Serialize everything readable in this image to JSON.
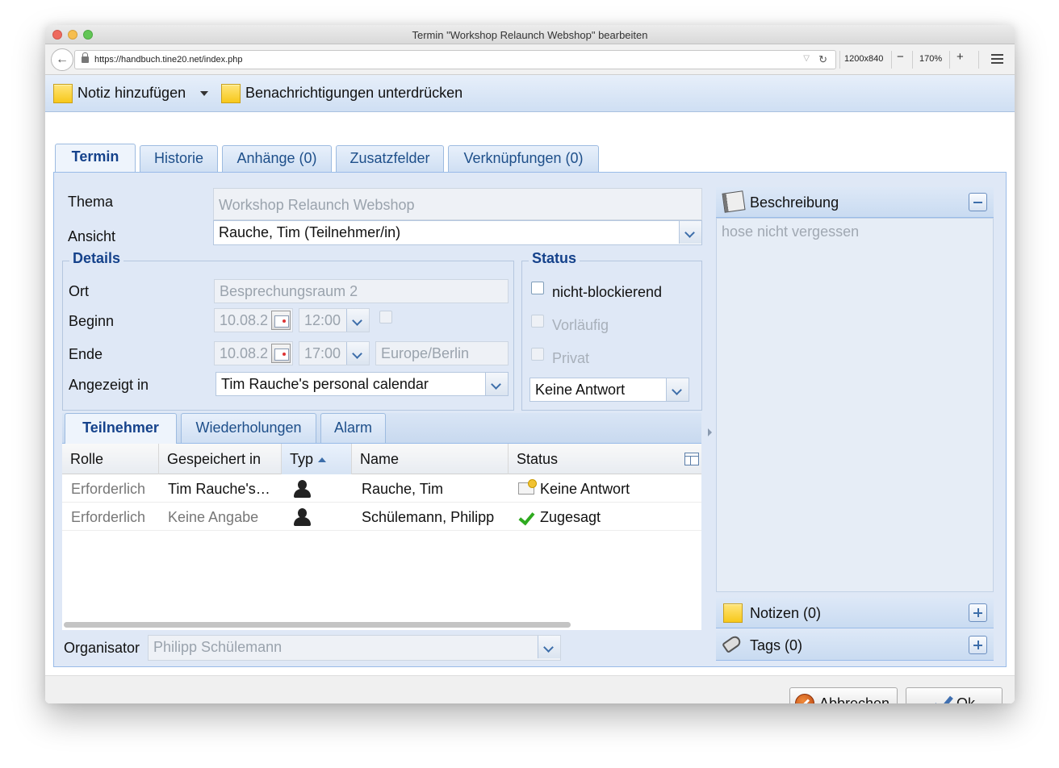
{
  "window": {
    "title": "Termin \"Workshop Relaunch Webshop\" bearbeiten"
  },
  "browser": {
    "url": "https://handbuch.tine20.net/index.php",
    "viewport": "1200x840",
    "zoom": "170%",
    "zoom_out": "−",
    "zoom_in": "+"
  },
  "toolbar": {
    "add_note": "Notiz hinzufügen",
    "suppress_notifications": "Benachrichtigungen unterdrücken"
  },
  "tabs": [
    "Termin",
    "Historie",
    "Anhänge (0)",
    "Zusatzfelder",
    "Verknüpfungen (0)"
  ],
  "form": {
    "thema_label": "Thema",
    "thema_placeholder": "Workshop Relaunch Webshop",
    "ansicht_label": "Ansicht",
    "ansicht_value": "Rauche, Tim (Teilnehmer/in)"
  },
  "details": {
    "legend": "Details",
    "ort_label": "Ort",
    "ort_placeholder": "Besprechungsraum 2",
    "beginn_label": "Beginn",
    "beginn_date": "10.08.2",
    "beginn_time": "12:00",
    "ende_label": "Ende",
    "ende_date": "10.08.2",
    "ende_time": "17:00",
    "timezone": "Europe/Berlin",
    "calendar_label": "Angezeigt in",
    "calendar_value": "Tim Rauche's personal calendar"
  },
  "status": {
    "legend": "Status",
    "non_blocking": "nicht-blockierend",
    "tentative": "Vorläufig",
    "private": "Privat",
    "response": "Keine Antwort"
  },
  "subtabs": [
    "Teilnehmer",
    "Wiederholungen",
    "Alarm"
  ],
  "attendees": {
    "columns": [
      "Rolle",
      "Gespeichert in",
      "Typ",
      "Name",
      "Status"
    ],
    "rows": [
      {
        "role": "Erforderlich",
        "saved_in": "Tim Rauche's…",
        "name": "Rauche, Tim",
        "status": "Keine Antwort"
      },
      {
        "role": "Erforderlich",
        "saved_in": "Keine Angabe",
        "name": "Schülemann, Philipp",
        "status": "Zugesagt"
      }
    ]
  },
  "organizer": {
    "label": "Organisator",
    "value": "Philipp Schülemann"
  },
  "sidebar": {
    "description_title": "Beschreibung",
    "description_text": "hose nicht vergessen",
    "notes_title": "Notizen (0)",
    "tags_title": "Tags (0)"
  },
  "buttons": {
    "cancel": "Abbrechen",
    "ok": "Ok"
  }
}
